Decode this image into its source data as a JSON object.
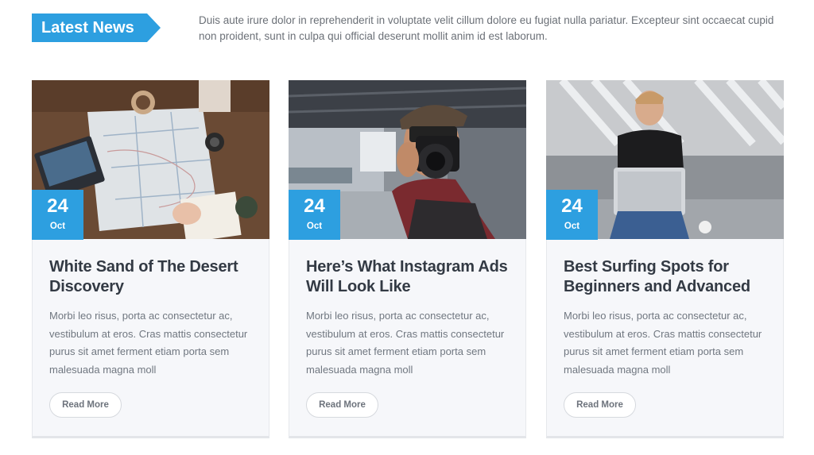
{
  "header": {
    "label": "Latest News",
    "intro": "Duis aute irure dolor in reprehenderit in voluptate velit cillum dolore eu fugiat nulla pariatur. Excepteur sint occaecat cupid non proident, sunt in culpa qui official deserunt mollit anim id est laborum."
  },
  "colors": {
    "accent": "#2d9fe0",
    "card_bg": "#f6f7fa",
    "title": "#333a44",
    "body_text": "#707780"
  },
  "posts": [
    {
      "image": "travel-map-desk-photo",
      "day": "24",
      "month": "Oct",
      "title": "White Sand of The Desert Discovery",
      "excerpt": "Morbi leo risus, porta ac consectetur ac, vestibulum at eros. Cras mattis consectetur purus sit amet ferment etiam porta sem malesuada magna moll",
      "button": "Read More"
    },
    {
      "image": "photographer-camera-photo",
      "day": "24",
      "month": "Oct",
      "title": "Here’s What Instagram Ads Will Look Like",
      "excerpt": "Morbi leo risus, porta ac consectetur ac, vestibulum at eros. Cras mattis consectetur purus sit amet ferment etiam porta sem malesuada magna moll",
      "button": "Read More"
    },
    {
      "image": "man-with-laptop-photo",
      "day": "24",
      "month": "Oct",
      "title": "Best Surfing Spots for Beginners and Advanced",
      "excerpt": "Morbi leo risus, porta ac consectetur ac, vestibulum at eros. Cras mattis consectetur purus sit amet ferment etiam porta sem malesuada magna moll",
      "button": "Read More"
    }
  ]
}
